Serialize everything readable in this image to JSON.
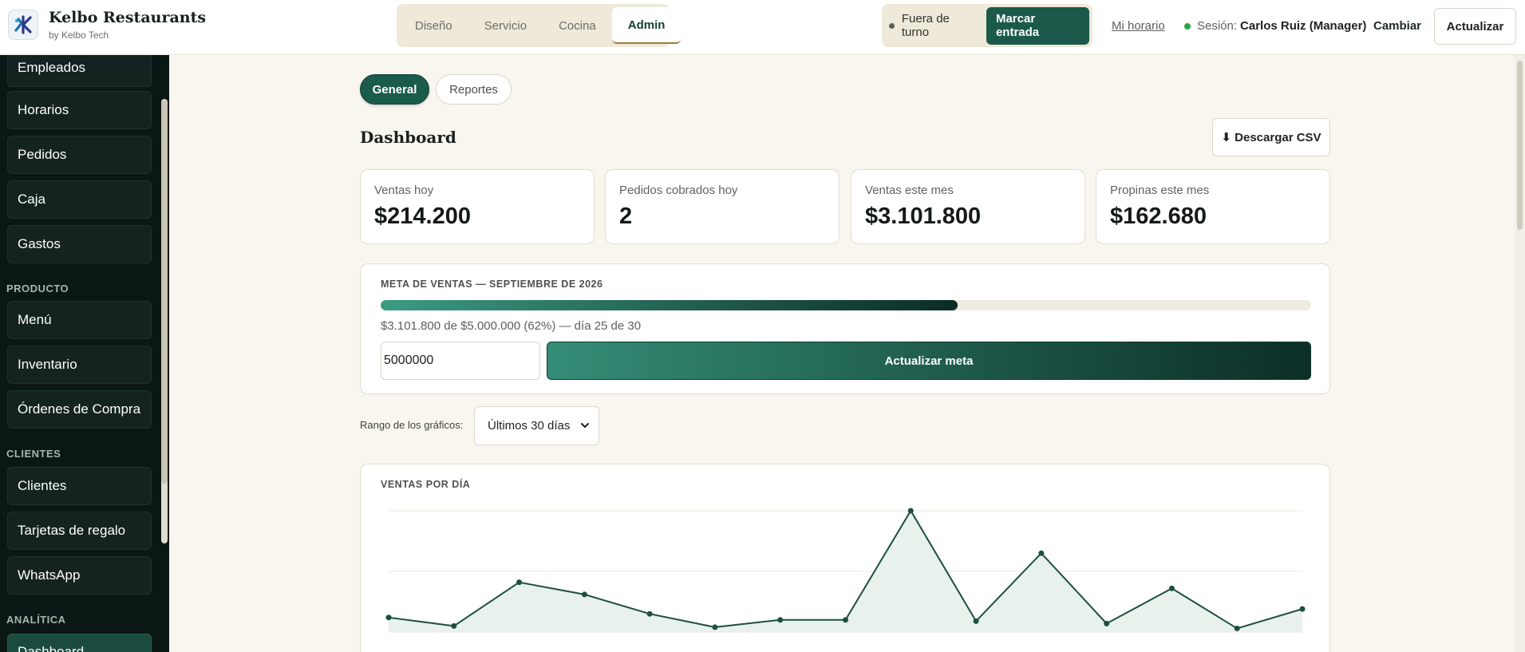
{
  "brand": {
    "title": "Kelbo Restaurants",
    "subtitle": "by Kelbo Tech"
  },
  "modes": [
    {
      "label": "Diseño",
      "active": false
    },
    {
      "label": "Servicio",
      "active": false
    },
    {
      "label": "Cocina",
      "active": false
    },
    {
      "label": "Admin",
      "active": true
    }
  ],
  "shift": {
    "status": "Fuera de turno",
    "clock_in_label": "Marcar entrada"
  },
  "header": {
    "my_schedule": "Mi horario",
    "session_label": "Sesión:",
    "session_user": "Carlos Ruiz (Manager)",
    "change_label": "Cambiar",
    "update_label": "Actualizar"
  },
  "sidebar": {
    "items": [
      {
        "label": "Empleados"
      },
      {
        "label": "Horarios"
      },
      {
        "label": "Pedidos"
      },
      {
        "label": "Caja"
      },
      {
        "label": "Gastos"
      },
      {
        "label": "Menú"
      },
      {
        "label": "Inventario"
      },
      {
        "label": "Órdenes de Compra"
      },
      {
        "label": "Clientes"
      },
      {
        "label": "Tarjetas de regalo"
      },
      {
        "label": "WhatsApp"
      },
      {
        "label": "Dashboard"
      }
    ],
    "sections": [
      "PRODUCTO",
      "CLIENTES",
      "ANALÍTICA"
    ]
  },
  "main": {
    "tabs": [
      {
        "label": "General"
      },
      {
        "label": "Reportes"
      }
    ],
    "title": "Dashboard",
    "download_label": "⬇ Descargar CSV",
    "kpis": [
      {
        "label": "Ventas hoy",
        "value": "$214.200"
      },
      {
        "label": "Pedidos cobrados hoy",
        "value": "2"
      },
      {
        "label": "Ventas este mes",
        "value": "$3.101.800"
      },
      {
        "label": "Propinas este mes",
        "value": "$162.680"
      }
    ],
    "goal": {
      "title": "META DE VENTAS — SEPTIEMBRE DE 2026",
      "progress": 0.62,
      "description": "$3.101.800 de $5.000.000 (62%) — día 25 de 30",
      "input_value": "5000000",
      "button_label": "Actualizar meta"
    },
    "range": {
      "label": "Rango de los gráficos:",
      "selected": "Últimos 30 días"
    },
    "chart_title": "VENTAS POR DÍA"
  },
  "colors": {
    "accent": "#1b5a4b",
    "sidebar_bg": "#0b1714",
    "page_bg": "#f8f6ee",
    "chart_line": "#1d4f43",
    "chart_fill": "#e4eee9"
  },
  "chart_data": {
    "type": "area",
    "title": "VENTAS POR DÍA",
    "xlabel": "",
    "ylabel": "",
    "ylim": [
      0,
      1
    ],
    "grid": true,
    "x": [
      1,
      2,
      3,
      4,
      5,
      6,
      7,
      8,
      9,
      10,
      11,
      12,
      13,
      14,
      15
    ],
    "series": [
      {
        "values": [
          0.12,
          0.05,
          0.41,
          0.31,
          0.15,
          0.04,
          0.1,
          0.1,
          1.0,
          0.09,
          0.65,
          0.07,
          0.36,
          0.03,
          0.19
        ]
      }
    ]
  }
}
